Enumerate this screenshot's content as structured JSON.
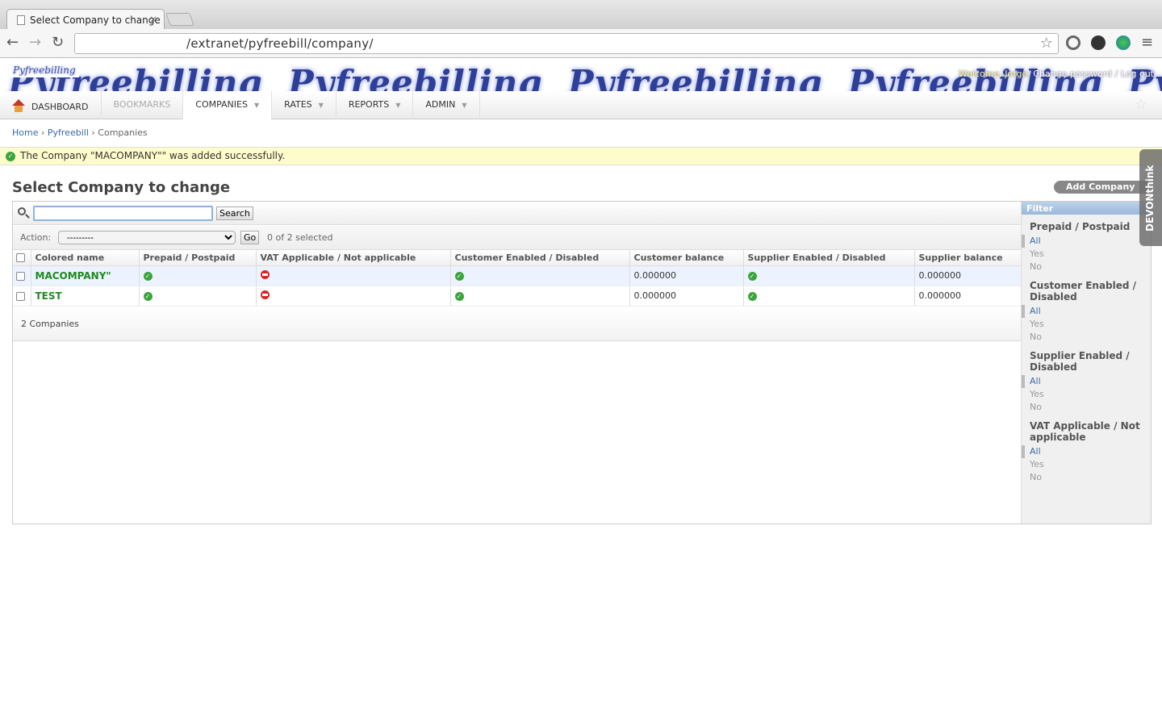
{
  "browser": {
    "tab_title": "Select Company to change",
    "url": "/extranet/pyfreebill/company/"
  },
  "banner": {
    "logo_text": "Pyfreebilling",
    "welcome": "Welcome, Jorge.",
    "change_password": "Change password",
    "separator": "/",
    "logout": "Log out"
  },
  "nav": {
    "items": [
      {
        "label": "DASHBOARD"
      },
      {
        "label": "BOOKMARKS"
      },
      {
        "label": "COMPANIES"
      },
      {
        "label": "RATES"
      },
      {
        "label": "REPORTS"
      },
      {
        "label": "ADMIN"
      }
    ]
  },
  "breadcrumbs": {
    "home": "Home",
    "app": "Pyfreebill",
    "current": "Companies",
    "sep": "›"
  },
  "message": "The Company \"MACOMPANY\"\" was added successfully.",
  "page": {
    "title": "Select Company to change",
    "add_button": "Add Company"
  },
  "search": {
    "value": "",
    "button": "Search"
  },
  "actions": {
    "label": "Action:",
    "selected": "---------",
    "go": "Go",
    "count": "0 of 2 selected"
  },
  "table": {
    "columns": [
      "Colored name",
      "Prepaid / Postpaid",
      "VAT Applicable / Not applicable",
      "Customer Enabled / Disabled",
      "Customer balance",
      "Supplier Enabled / Disabled",
      "Supplier balance"
    ],
    "rows": [
      {
        "name": "MACOMPANY\"",
        "prepaid": true,
        "vat": false,
        "customer_enabled": true,
        "customer_balance": "0.000000",
        "supplier_enabled": true,
        "supplier_balance": "0.000000"
      },
      {
        "name": "TEST",
        "prepaid": true,
        "vat": false,
        "customer_enabled": true,
        "customer_balance": "0.000000",
        "supplier_enabled": true,
        "supplier_balance": "0.000000"
      }
    ],
    "footer": "2 Companies"
  },
  "filter": {
    "title": "Filter",
    "groups": [
      {
        "title": "Prepaid / Postpaid",
        "options": [
          "All",
          "Yes",
          "No"
        ]
      },
      {
        "title": "Customer Enabled / Disabled",
        "options": [
          "All",
          "Yes",
          "No"
        ]
      },
      {
        "title": "Supplier Enabled / Disabled",
        "options": [
          "All",
          "Yes",
          "No"
        ]
      },
      {
        "title": "VAT Applicable / Not applicable",
        "options": [
          "All",
          "Yes",
          "No"
        ]
      }
    ]
  },
  "devonthink": "DEVONthink",
  "colors": {
    "success": "#3aa53a",
    "error": "#dd2222",
    "name_link": "#1c8a1c",
    "link": "#3a6aa8",
    "message_bg": "#fffccc"
  }
}
